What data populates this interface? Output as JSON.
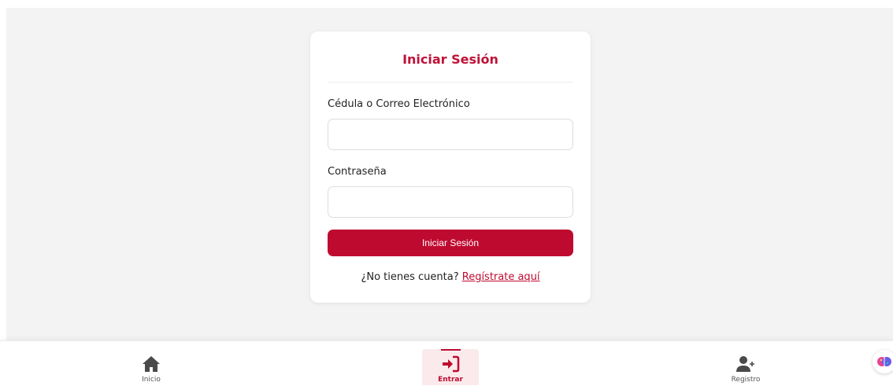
{
  "login_form": {
    "title": "Iniciar Sesión",
    "user_label": "Cédula o Correo Electrónico",
    "user_value": "",
    "password_label": "Contraseña",
    "password_value": "",
    "submit_label": "Iniciar Sesión",
    "signup_prompt": "¿No tienes cuenta?",
    "signup_link": "Regístrate aquí"
  },
  "bottom_nav": {
    "items": [
      {
        "label": "Inicio",
        "icon": "home-icon",
        "active": false
      },
      {
        "label": "Entrar",
        "icon": "sign-in-icon",
        "active": true
      },
      {
        "label": "Registro",
        "icon": "user-plus-icon",
        "active": false
      }
    ]
  },
  "assistant": {
    "icon": "brain-icon"
  },
  "colors": {
    "accent": "#bf0a30",
    "page_background": "#f3f3f4",
    "card_background": "#ffffff",
    "active_tab_background": "#fbeaec"
  }
}
